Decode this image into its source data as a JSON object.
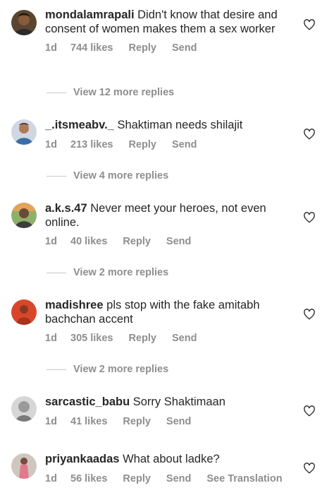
{
  "comments": [
    {
      "username": "mondalamrapali",
      "text": "Didn't know that desire and consent of women makes them a sex worker",
      "time": "1d",
      "likes": "744 likes",
      "reply_label": "Reply",
      "send_label": "Send",
      "view_more": "View 12 more replies"
    },
    {
      "username": "_.itsmeabv._",
      "text": "Shaktiman needs shilajit",
      "time": "1d",
      "likes": "213 likes",
      "reply_label": "Reply",
      "send_label": "Send",
      "view_more": "View 4 more replies"
    },
    {
      "username": "a.k.s.47",
      "text": "Never meet your heroes, not even online.",
      "time": "1d",
      "likes": "40 likes",
      "reply_label": "Reply",
      "send_label": "Send",
      "view_more": "View 2 more replies"
    },
    {
      "username": "madishree",
      "text": "pls stop with the fake amitabh bachchan accent",
      "time": "1d",
      "likes": "305 likes",
      "reply_label": "Reply",
      "send_label": "Send",
      "view_more": "View 2 more replies"
    },
    {
      "username": "sarcastic_babu",
      "text": "Sorry Shaktimaan",
      "time": "1d",
      "likes": "41 likes",
      "reply_label": "Reply",
      "send_label": "Send"
    },
    {
      "username": "priyankaadas",
      "text": "What about ladke?",
      "time": "1d",
      "likes": "56 likes",
      "reply_label": "Reply",
      "send_label": "Send",
      "translation_label": "See Translation"
    }
  ],
  "icons": {
    "like": "heart-outline-icon"
  },
  "colors": {
    "text": "#262626",
    "muted": "#8e8e8e",
    "divider": "#c7c7c7"
  }
}
